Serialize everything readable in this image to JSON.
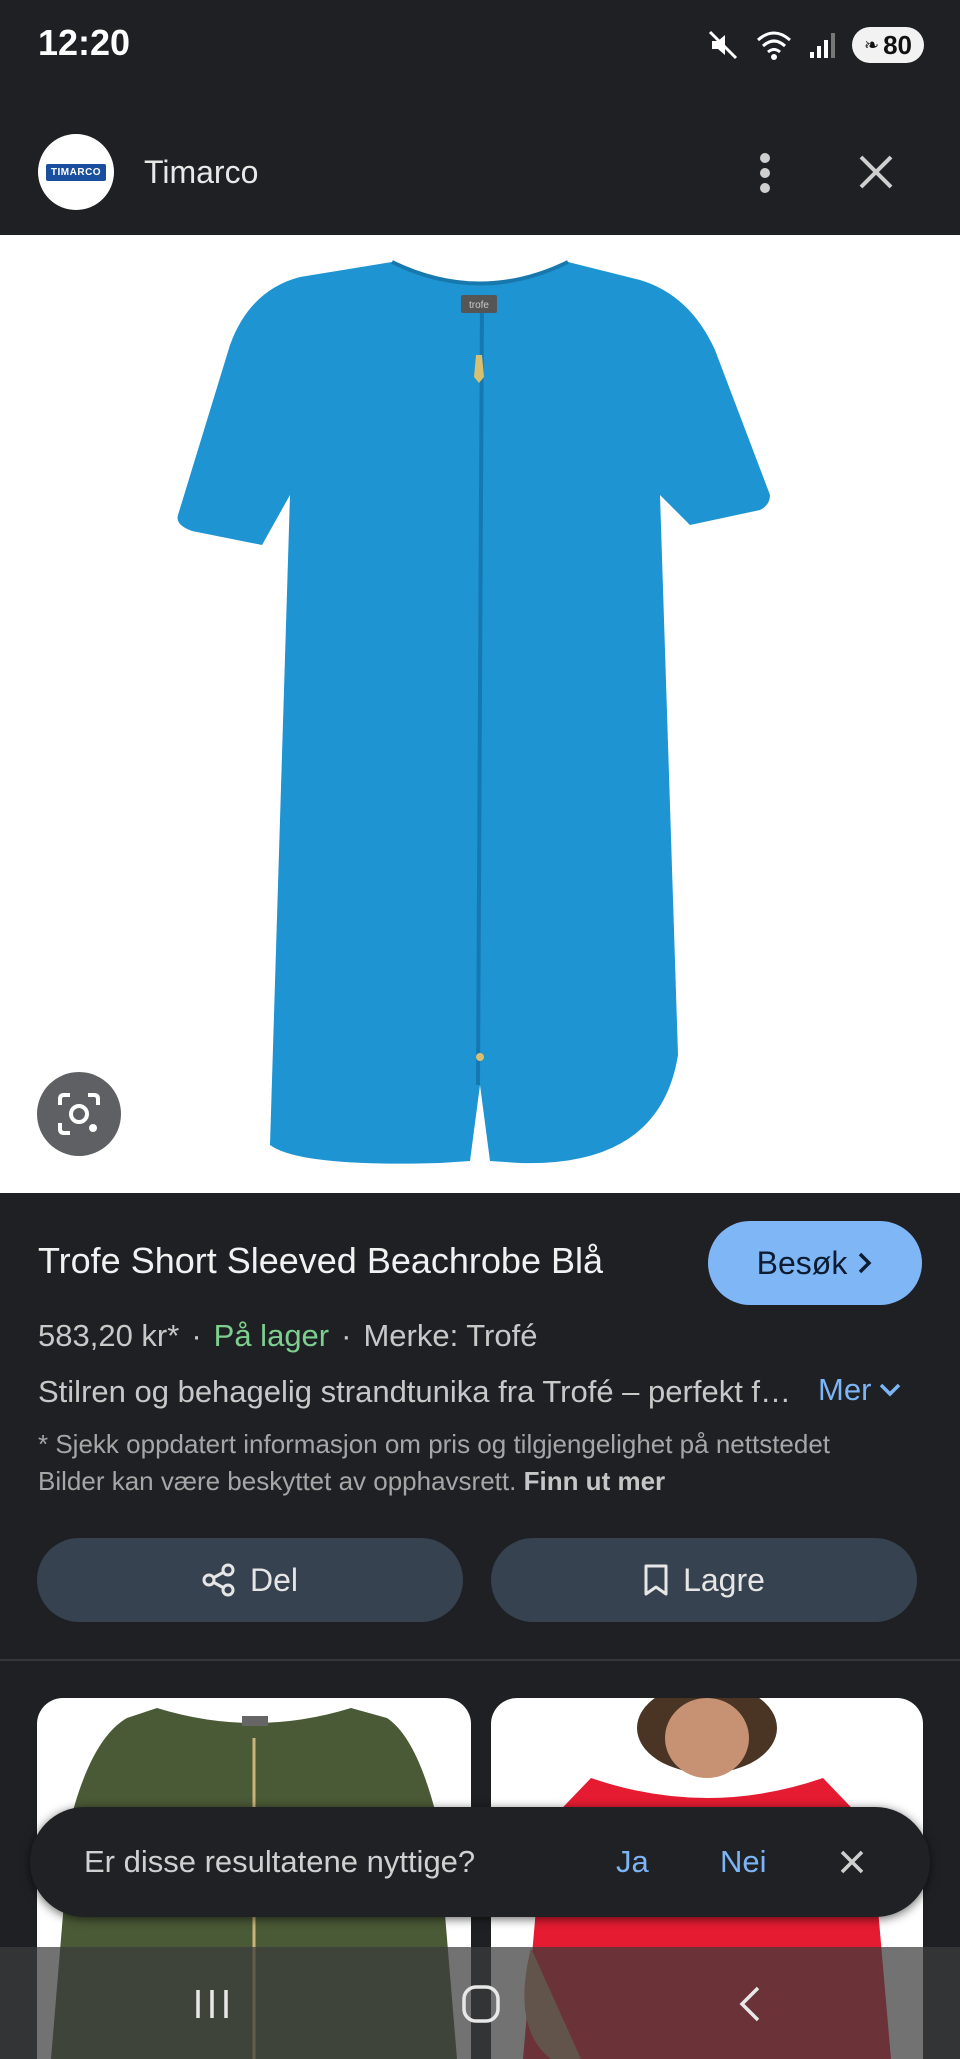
{
  "status_bar": {
    "time": "12:20",
    "battery": "80"
  },
  "header": {
    "site_name": "Timarco",
    "logo_text": "TIMARCO"
  },
  "image": {
    "label_tag": "trofe"
  },
  "product": {
    "title": "Trofe Short Sleeved Beachrobe Blå",
    "visit_label": "Besøk",
    "price": "583,20 kr*",
    "stock": "På lager",
    "brand": "Merke: Trofé",
    "description": "Stilren og behagelig strandtunika fra Trofé – perfekt for stranden",
    "more_label": "Mer",
    "disclaimer": "* Sjekk oppdatert informasjon om pris og tilgjengelighet på nettstedet Bilder kan være beskyttet av opphavsrett.",
    "learn_more": "Finn ut mer"
  },
  "actions": {
    "share_label": "Del",
    "save_label": "Lagre"
  },
  "feedback": {
    "question": "Er disse resultatene nyttige?",
    "yes": "Ja",
    "no": "Nei"
  },
  "colors": {
    "accent": "#7fb7f6",
    "background": "#1f2024",
    "in_stock": "#7ccf8e",
    "robe": "#1e94d3"
  }
}
